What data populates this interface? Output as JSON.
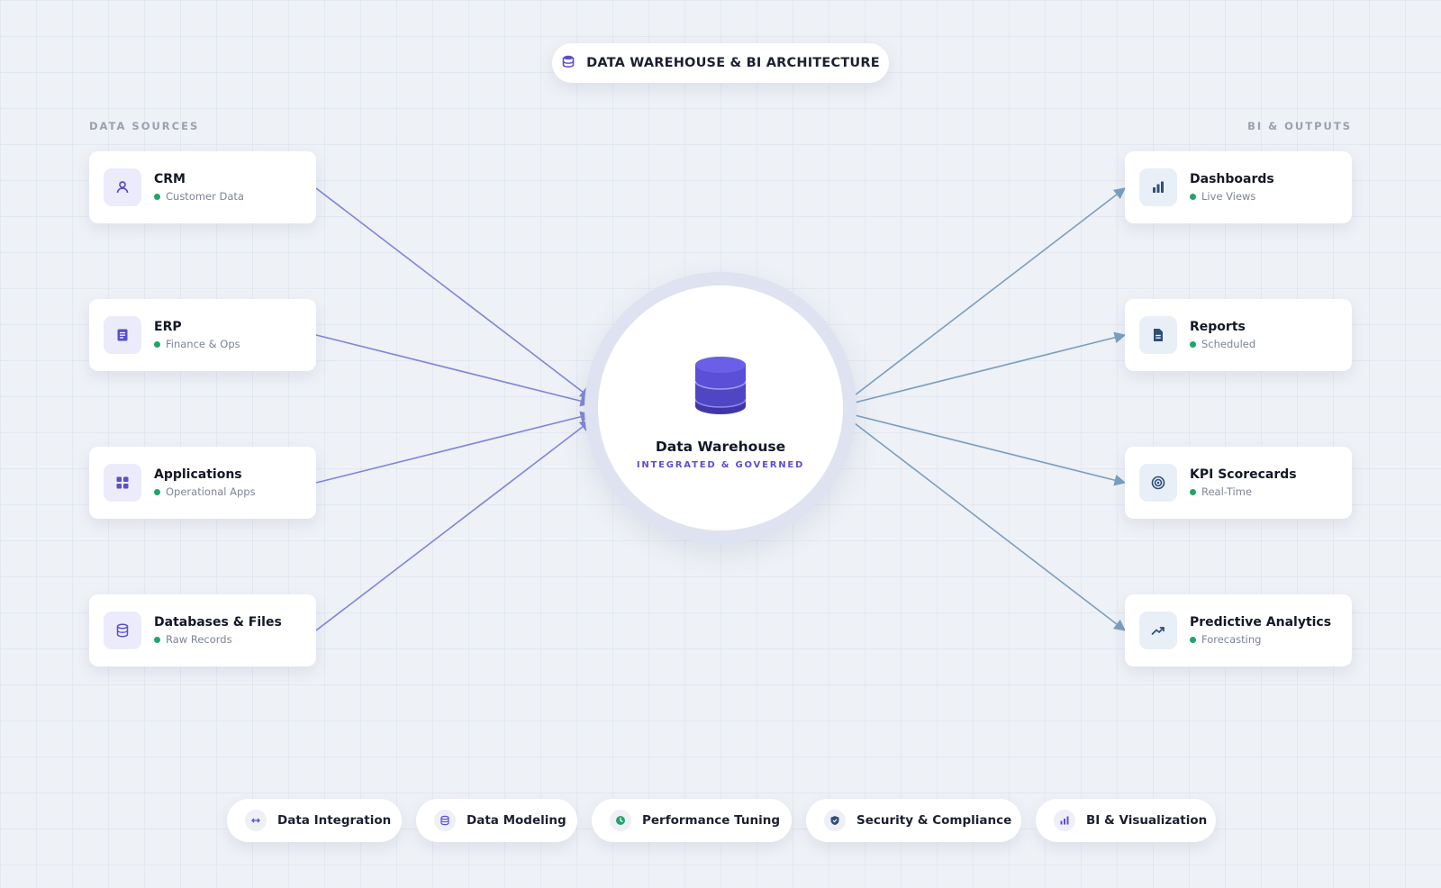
{
  "header": {
    "title": "DATA WAREHOUSE & BI ARCHITECTURE",
    "icon": "database-icon"
  },
  "sections": {
    "sources_label": "DATA SOURCES",
    "outputs_label": "BI & OUTPUTS"
  },
  "sources": [
    {
      "title": "CRM",
      "subtitle": "Customer Data",
      "icon": "user-icon"
    },
    {
      "title": "ERP",
      "subtitle": "Finance & Ops",
      "icon": "document-icon"
    },
    {
      "title": "Applications",
      "subtitle": "Operational Apps",
      "icon": "grid-icon"
    },
    {
      "title": "Databases & Files",
      "subtitle": "Raw Records",
      "icon": "database-icon"
    }
  ],
  "outputs": [
    {
      "title": "Dashboards",
      "subtitle": "Live Views",
      "icon": "bar-chart-icon"
    },
    {
      "title": "Reports",
      "subtitle": "Scheduled",
      "icon": "file-icon"
    },
    {
      "title": "KPI Scorecards",
      "subtitle": "Real-Time",
      "icon": "target-icon"
    },
    {
      "title": "Predictive Analytics",
      "subtitle": "Forecasting",
      "icon": "trend-up-icon"
    }
  ],
  "hub": {
    "title": "Data Warehouse",
    "subtitle": "INTEGRATED & GOVERNED",
    "icon": "database-stack-icon"
  },
  "capabilities": [
    {
      "label": "Data Integration",
      "icon": "arrows-horizontal-icon"
    },
    {
      "label": "Data Modeling",
      "icon": "database-icon"
    },
    {
      "label": "Performance Tuning",
      "icon": "clock-icon"
    },
    {
      "label": "Security & Compliance",
      "icon": "shield-icon"
    },
    {
      "label": "BI & Visualization",
      "icon": "bar-chart-icon"
    }
  ],
  "colors": {
    "source_arrow": "#7f86d6",
    "output_arrow": "#7a9fbe",
    "accent": "#5a4fcf",
    "status_dot": "#1fa56b"
  }
}
